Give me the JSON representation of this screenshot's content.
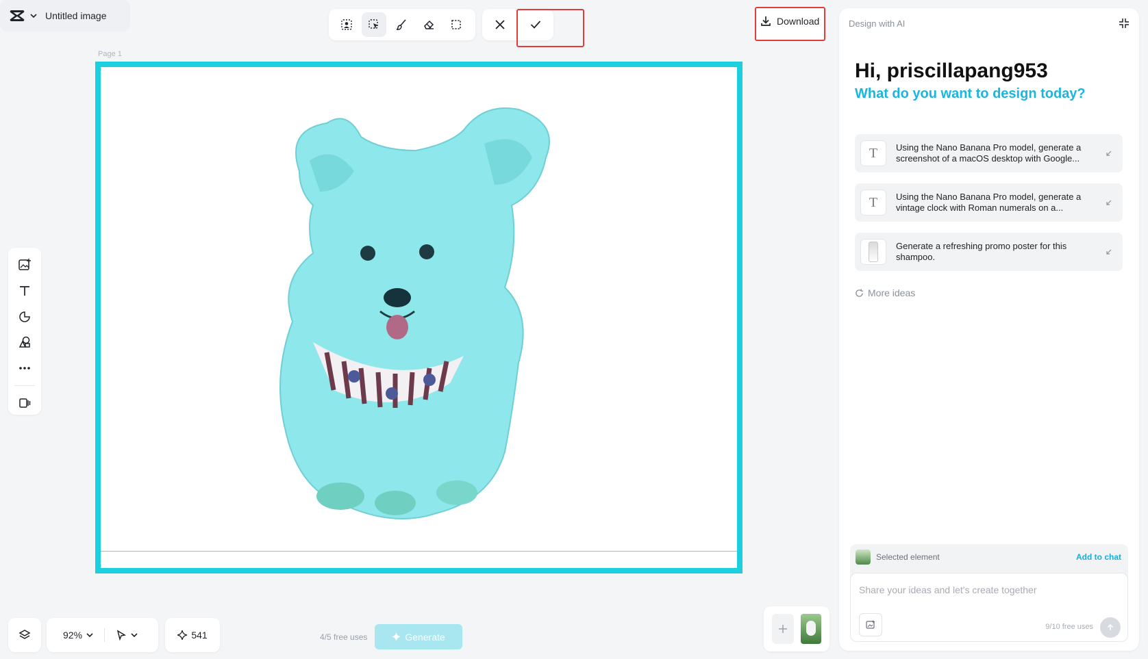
{
  "file": {
    "title": "Untitled image"
  },
  "toolbar": {
    "tools": [
      "person-select-icon",
      "smart-select-icon",
      "brush-icon",
      "eraser-icon",
      "marquee-icon"
    ],
    "cancel": "close-icon",
    "confirm": "check-icon"
  },
  "download": {
    "label": "Download"
  },
  "canvas": {
    "page_label": "Page 1",
    "frame_color": "#1ccfdf"
  },
  "left_toolbar": [
    "add-image-icon",
    "text-icon",
    "shapes-icon",
    "elements-icon",
    "more-icon",
    "video-icon"
  ],
  "bottom": {
    "zoom": "92%",
    "credits": "541",
    "free_uses": "4/5 free uses",
    "generate_label": "Generate"
  },
  "ai_panel": {
    "title": "Design with AI",
    "greeting": "Hi, priscillapang953",
    "subheading": "What do you want to design today?",
    "ideas": [
      {
        "icon": "T",
        "text": "Using the Nano Banana Pro model, generate a screenshot of a macOS desktop with Google..."
      },
      {
        "icon": "T",
        "text": "Using the Nano Banana Pro model, generate a vintage clock with Roman numerals on a..."
      },
      {
        "icon": "shampoo-bottle",
        "text": "Generate a refreshing promo poster for this shampoo."
      }
    ],
    "more_ideas": "More ideas",
    "chat": {
      "selected_label": "Selected element",
      "add_to_chat": "Add to chat",
      "placeholder": "Share your ideas and let's create together",
      "uses": "9/10 free uses"
    }
  }
}
